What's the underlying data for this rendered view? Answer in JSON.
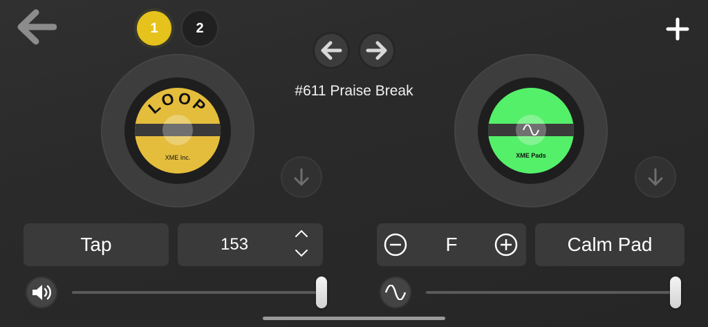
{
  "header": {
    "back_icon": "back-arrow-icon",
    "pages": [
      "1",
      "2"
    ],
    "active_page": "1",
    "add_icon": "plus-icon",
    "accent_color": "#e6c21c"
  },
  "nav": {
    "prev_icon": "arrow-left-icon",
    "next_icon": "arrow-right-icon"
  },
  "song": {
    "title": "#611 Praise Break"
  },
  "left_disc": {
    "arc_text": "LOOP",
    "brand": "XME Inc.",
    "label_color": "#e4bd3d"
  },
  "right_disc": {
    "brand": "XME Pads",
    "label_color": "#55f06a",
    "center_icon": "sine-wave-icon"
  },
  "left_panel": {
    "tap_label": "Tap",
    "tempo_value": "153"
  },
  "right_panel": {
    "key_value": "F",
    "pad_label": "Calm Pad"
  },
  "sliders": {
    "volume_icon": "speaker-icon",
    "volume_level": 1.0,
    "pad_icon": "sine-wave-icon",
    "pad_level": 1.0
  }
}
